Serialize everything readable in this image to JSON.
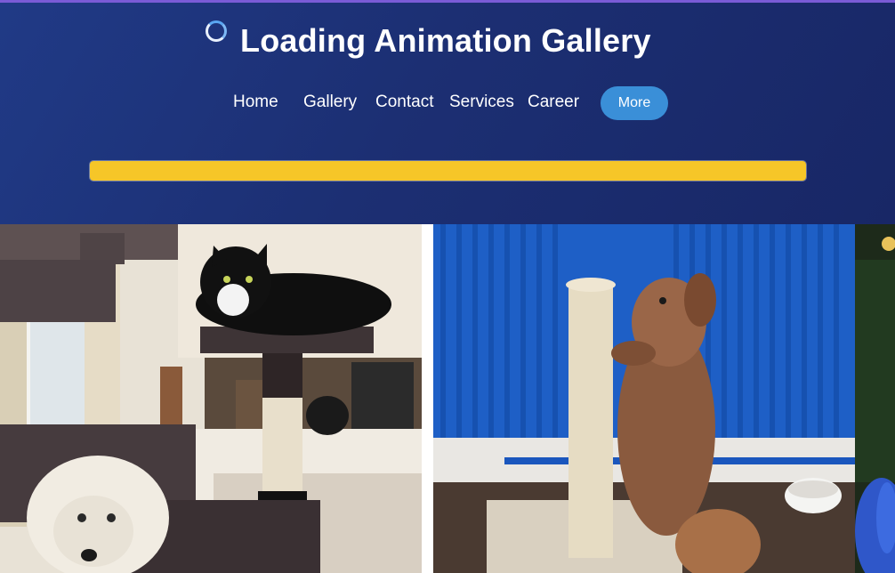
{
  "header": {
    "title": "Loading Animation Gallery",
    "spinner_icon": "spinner-icon",
    "colors": {
      "background": "#1c2f73",
      "accent": "#3a8fd8",
      "progress": "#f6c628"
    }
  },
  "nav": {
    "items": [
      {
        "label": "Home"
      },
      {
        "label": "Gallery"
      },
      {
        "label": "Contact"
      },
      {
        "label": "Services"
      },
      {
        "label": "Career"
      }
    ],
    "more_label": "More"
  },
  "progress": {
    "value": 1.0
  },
  "gallery": {
    "photos": [
      {
        "name": "photo-cats-and-dog-cat-tree"
      },
      {
        "name": "photo-dog-scratching-post"
      },
      {
        "name": "photo-partial-bird"
      }
    ]
  }
}
